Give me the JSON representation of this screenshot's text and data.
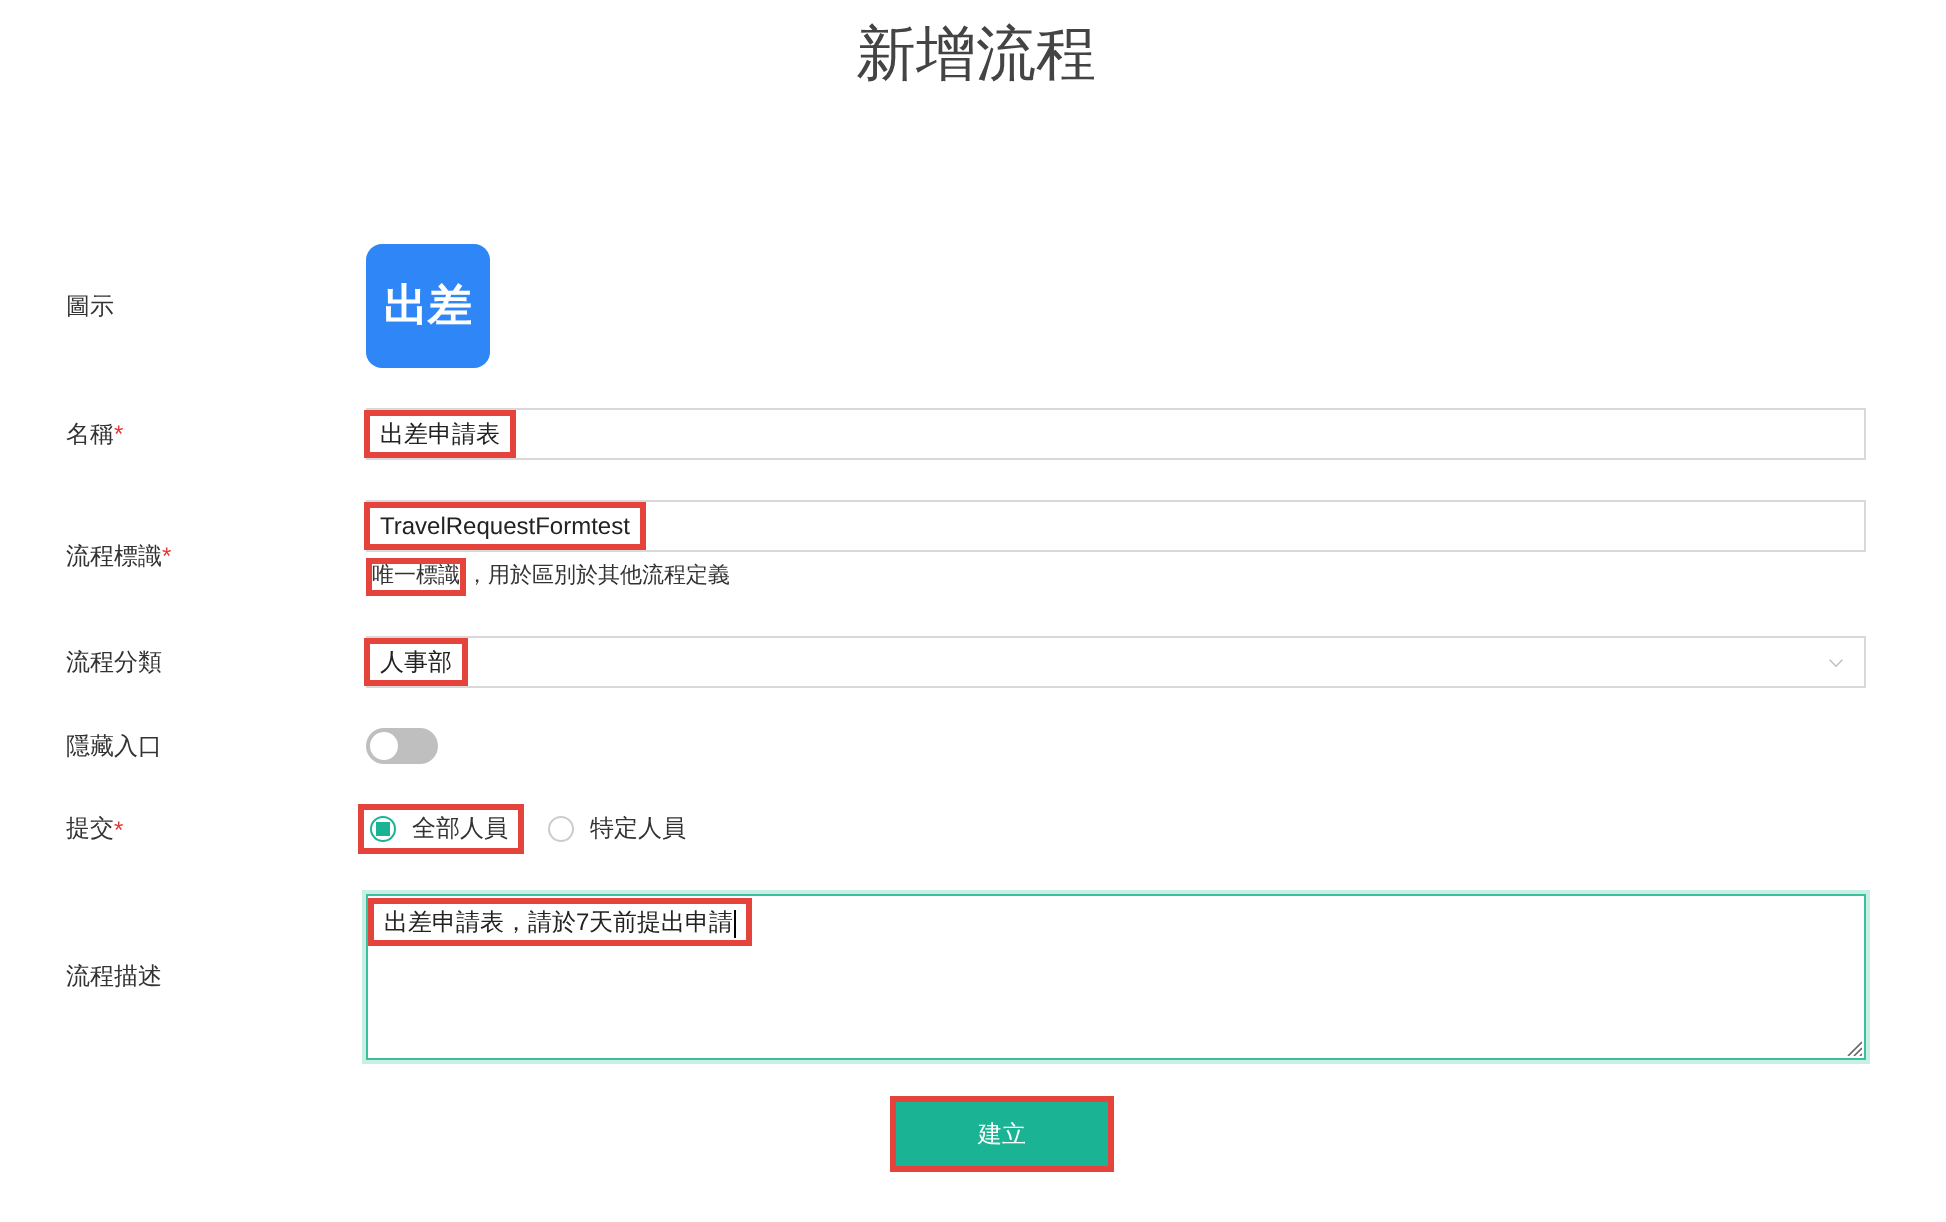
{
  "title": "新增流程",
  "icon_row": {
    "label": "圖示",
    "icon_text": "出差"
  },
  "name_row": {
    "label": "名稱",
    "mark": "*",
    "value": "出差申請表",
    "highlighted": true
  },
  "id_row": {
    "label": "流程標識",
    "mark": "*",
    "value": "TravelRequestFormtest",
    "highlighted": true,
    "hint": [
      {
        "text": "唯一標識",
        "highlighted": true
      },
      {
        "text": "，用於區別於其他流程定義",
        "highlighted": false
      }
    ]
  },
  "category_row": {
    "label": "流程分類",
    "value": "人事部",
    "highlighted": true
  },
  "hide_row": {
    "label": "隱藏入口",
    "on": false
  },
  "submit_row": {
    "label": "提交",
    "mark": "*",
    "options": [
      {
        "label": "全部人員",
        "selected": true,
        "highlighted": true
      },
      {
        "label": "特定人員",
        "selected": false,
        "highlighted": false
      }
    ]
  },
  "description_row": {
    "label": "流程描述",
    "value": "出差申請表，請於7天前提出申請",
    "highlighted": true,
    "focused": true
  },
  "create_button": {
    "label": "建立",
    "highlighted": true
  }
}
